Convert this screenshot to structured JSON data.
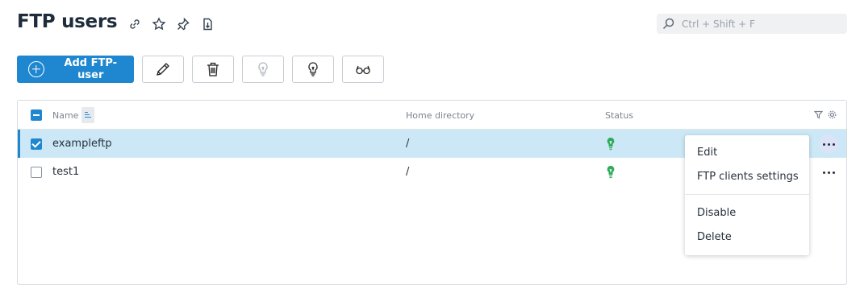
{
  "header": {
    "title": "FTP users",
    "icons": [
      "link-icon",
      "star-icon",
      "pin-icon",
      "export-icon"
    ]
  },
  "search": {
    "placeholder": "Ctrl + Shift + F",
    "value": ""
  },
  "toolbar": {
    "add_label": "Add FTP-user",
    "buttons": [
      "edit-pencil-icon",
      "delete-trash-icon",
      "disable-bulb-icon",
      "enable-bulb-icon",
      "view-glasses-icon"
    ]
  },
  "table": {
    "columns": {
      "name": "Name",
      "home": "Home directory",
      "status": "Status"
    },
    "rows": [
      {
        "name": "exampleftp",
        "home": "/",
        "status": "active",
        "selected": true
      },
      {
        "name": "test1",
        "home": "/",
        "status": "active",
        "selected": false
      }
    ]
  },
  "context_menu": {
    "items": [
      "Edit",
      "FTP clients settings",
      "Disable",
      "Delete"
    ]
  },
  "colors": {
    "accent": "#1f87d0",
    "selected_row": "#cce8f7",
    "status_active": "#2eab5a"
  }
}
